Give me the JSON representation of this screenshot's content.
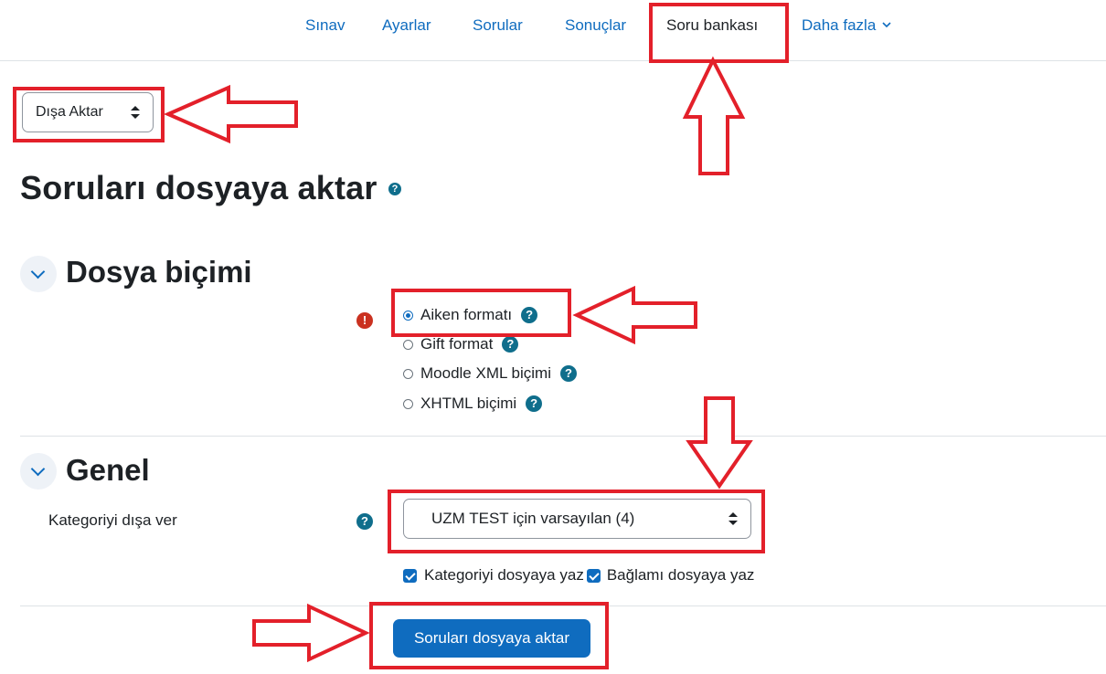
{
  "nav": {
    "items": [
      "Sınav",
      "Ayarlar",
      "Sorular",
      "Sonuçlar",
      "Soru bankası"
    ],
    "more_label": "Daha fazla"
  },
  "action_select": {
    "value": "Dışa Aktar"
  },
  "page_title": "Soruları dosyaya aktar",
  "sections": {
    "format": {
      "title": "Dosya biçimi",
      "options": [
        {
          "label": "Aiken formatı",
          "checked": true
        },
        {
          "label": "Gift format",
          "checked": false
        },
        {
          "label": "Moodle XML biçimi",
          "checked": false
        },
        {
          "label": "XHTML biçimi",
          "checked": false
        }
      ]
    },
    "general": {
      "title": "Genel",
      "category_label": "Kategoriyi dışa ver",
      "category_value": "UZM TEST için varsayılan (4)",
      "checkbox_category": "Kategoriyi dosyaya yaz",
      "checkbox_context": "Bağlamı dosyaya yaz"
    }
  },
  "submit_label": "Soruları dosyaya aktar",
  "icons": {
    "help": "question-circle-icon",
    "error": "exclamation-circle-icon",
    "collapse": "chevron-down-icon"
  },
  "colors": {
    "link": "#0f6cbf",
    "annotation": "#e3202a",
    "help": "#0f6e8c",
    "error": "#ca3120"
  }
}
